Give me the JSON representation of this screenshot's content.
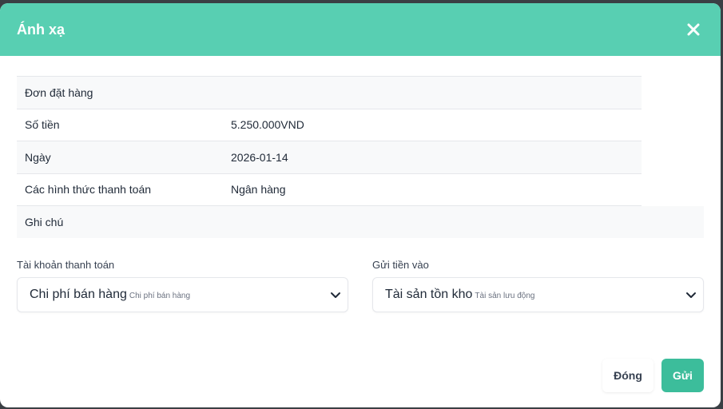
{
  "modal": {
    "title": "Ánh xạ",
    "close_icon": "close-icon",
    "header_color": "#58cfb2"
  },
  "info": {
    "order_label": "Đơn đặt hàng",
    "rows": [
      {
        "label": "Số tiền",
        "value": "5.250.000VND"
      },
      {
        "label": "Ngày",
        "value": "2026-01-14"
      },
      {
        "label": "Các hình thức thanh toán",
        "value": "Ngân hàng"
      }
    ],
    "note_label": "Ghi chú"
  },
  "payment_account": {
    "label": "Tài khoản thanh toán",
    "selected": "Chi phí bán hàng",
    "selected_sub": "Chi phí bán hàng"
  },
  "deposit_to": {
    "label": "Gửi tiền vào",
    "selected": "Tài sản tồn kho",
    "selected_sub": "Tài sản lưu động"
  },
  "footer": {
    "close_label": "Đóng",
    "submit_label": "Gửi",
    "submit_color": "#3cbd9b"
  }
}
